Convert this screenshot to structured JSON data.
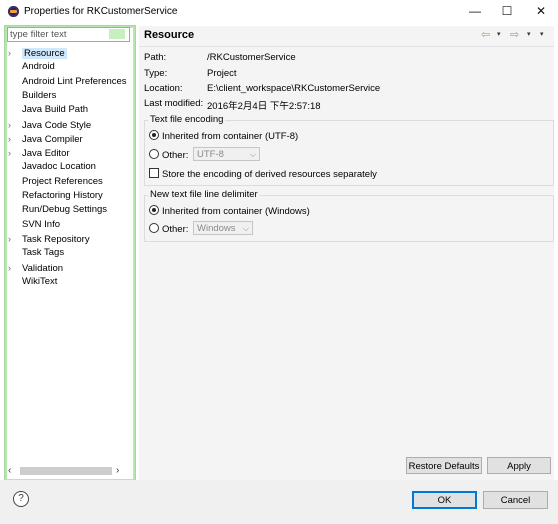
{
  "window": {
    "title": "Properties for RKCustomerService",
    "minimize_glyph": "—",
    "maximize_glyph": "☐",
    "close_glyph": "✕"
  },
  "filter": {
    "placeholder": "type filter text"
  },
  "tree": {
    "items": [
      {
        "label": "Resource",
        "expandable": true,
        "selected": true
      },
      {
        "label": "Android",
        "expandable": false,
        "selected": false
      },
      {
        "label": "Android Lint Preferences",
        "expandable": false,
        "selected": false
      },
      {
        "label": "Builders",
        "expandable": false,
        "selected": false
      },
      {
        "label": "Java Build Path",
        "expandable": false,
        "selected": false
      },
      {
        "label": "Java Code Style",
        "expandable": true,
        "selected": false
      },
      {
        "label": "Java Compiler",
        "expandable": true,
        "selected": false
      },
      {
        "label": "Java Editor",
        "expandable": true,
        "selected": false
      },
      {
        "label": "Javadoc Location",
        "expandable": false,
        "selected": false
      },
      {
        "label": "Project References",
        "expandable": false,
        "selected": false
      },
      {
        "label": "Refactoring History",
        "expandable": false,
        "selected": false
      },
      {
        "label": "Run/Debug Settings",
        "expandable": false,
        "selected": false
      },
      {
        "label": "SVN Info",
        "expandable": false,
        "selected": false
      },
      {
        "label": "Task Repository",
        "expandable": true,
        "selected": false
      },
      {
        "label": "Task Tags",
        "expandable": false,
        "selected": false
      },
      {
        "label": "Validation",
        "expandable": true,
        "selected": false
      },
      {
        "label": "WikiText",
        "expandable": false,
        "selected": false
      }
    ],
    "scroll_left_glyph": "‹",
    "scroll_right_glyph": "›"
  },
  "page": {
    "title": "Resource",
    "nav_back_glyph": "⇦",
    "nav_forward_glyph": "⇨",
    "dropdown_glyph": "▾"
  },
  "properties": {
    "path_label": "Path:",
    "path_value": "/RKCustomerService",
    "type_label": "Type:",
    "type_value": "Project",
    "location_label": "Location:",
    "location_value": "E:\\client_workspace\\RKCustomerService",
    "modified_label": "Last modified:",
    "modified_value": "2016年2月4日 下午2:57:18"
  },
  "encoding": {
    "title": "Text file encoding",
    "inherited_label": "Inherited from container (UTF-8)",
    "other_label": "Other:",
    "other_value": "UTF-8",
    "store_label": "Store the encoding of derived resources separately"
  },
  "delimiter": {
    "title": "New text file line delimiter",
    "inherited_label": "Inherited from container (Windows)",
    "other_label": "Other:",
    "other_value": "Windows"
  },
  "buttons": {
    "restore_defaults": "Restore Defaults",
    "apply": "Apply",
    "ok": "OK",
    "cancel": "Cancel",
    "help": "?"
  }
}
